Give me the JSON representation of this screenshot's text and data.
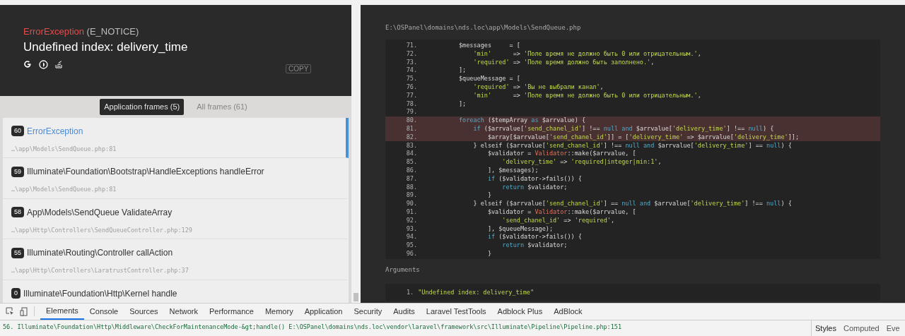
{
  "exception": {
    "class": "ErrorException",
    "type": "(E_NOTICE)",
    "message": "Undefined index: delivery_time",
    "copy_label": "COPY"
  },
  "frame_tabs": [
    {
      "label": "Application frames (5)",
      "selected": true
    },
    {
      "label": "All frames (61)",
      "selected": false
    }
  ],
  "frames": [
    {
      "number": "60",
      "name": "ErrorException",
      "file": "…\\app\\Models\\SendQueue.php:81",
      "selected": true
    },
    {
      "number": "59",
      "name": "Illuminate\\Foundation\\Bootstrap\\HandleExceptions handleError",
      "file": "…\\app\\Models\\SendQueue.php:81",
      "selected": false
    },
    {
      "number": "58",
      "name": "App\\Models\\SendQueue ValidateArray",
      "file": "…\\app\\Http\\Controllers\\SendQueueController.php:129",
      "selected": false
    },
    {
      "number": "55",
      "name": "Illuminate\\Routing\\Controller callAction",
      "file": "…\\app\\Http\\Controllers\\LaratrustController.php:37",
      "selected": false
    },
    {
      "number": "0",
      "name": "Illuminate\\Foundation\\Http\\Kernel handle",
      "selected": false
    }
  ],
  "code": {
    "path": "E:\\OSPanel\\domains\\nds.loc\\app\\Models\\SendQueue.php",
    "lines": [
      {
        "number": "71.",
        "highlighted": false,
        "tokens": [
          {
            "kind": "plain",
            "text": "        $messages     = ["
          }
        ]
      },
      {
        "number": "72.",
        "highlighted": false,
        "tokens": [
          {
            "kind": "string",
            "text": "            'min'"
          },
          {
            "kind": "plain",
            "text": "      => "
          },
          {
            "kind": "string",
            "text": "'Поле время не должно быть 0 или отрицательным.'"
          },
          {
            "kind": "plain",
            "text": ","
          }
        ]
      },
      {
        "number": "73.",
        "highlighted": false,
        "tokens": [
          {
            "kind": "string",
            "text": "            'required'"
          },
          {
            "kind": "plain",
            "text": " => "
          },
          {
            "kind": "string",
            "text": "'Поле время должно быть заполнено.'"
          },
          {
            "kind": "plain",
            "text": ","
          }
        ]
      },
      {
        "number": "74.",
        "highlighted": false,
        "tokens": [
          {
            "kind": "plain",
            "text": "        ];"
          }
        ]
      },
      {
        "number": "75.",
        "highlighted": false,
        "tokens": [
          {
            "kind": "plain",
            "text": "        $queueMessage = ["
          }
        ]
      },
      {
        "number": "76.",
        "highlighted": false,
        "tokens": [
          {
            "kind": "string",
            "text": "            'required'"
          },
          {
            "kind": "plain",
            "text": " => "
          },
          {
            "kind": "string",
            "text": "'Вы не выбрали канал'"
          },
          {
            "kind": "plain",
            "text": ","
          }
        ]
      },
      {
        "number": "77.",
        "highlighted": false,
        "tokens": [
          {
            "kind": "string",
            "text": "            'min'"
          },
          {
            "kind": "plain",
            "text": "      => "
          },
          {
            "kind": "string",
            "text": "'Поле время не должно быть 0 или отрицательным.'"
          },
          {
            "kind": "plain",
            "text": ","
          }
        ]
      },
      {
        "number": "78.",
        "highlighted": false,
        "tokens": [
          {
            "kind": "plain",
            "text": "        ];"
          }
        ]
      },
      {
        "number": "79.",
        "highlighted": false
      },
      {
        "number": "80.",
        "highlighted": true,
        "tokens": [
          {
            "kind": "keyword",
            "text": "        foreach"
          },
          {
            "kind": "plain",
            "text": " ($tempArray "
          },
          {
            "kind": "keyword",
            "text": "as"
          },
          {
            "kind": "plain",
            "text": " $arrvalue) {"
          }
        ]
      },
      {
        "number": "81.",
        "highlighted": true,
        "tokens": [
          {
            "kind": "keyword",
            "text": "            if"
          },
          {
            "kind": "plain",
            "text": " ($arrvalue["
          },
          {
            "kind": "string",
            "text": "'send_chanel_id'"
          },
          {
            "kind": "plain",
            "text": "] !== "
          },
          {
            "kind": "keyword",
            "text": "null and"
          },
          {
            "kind": "plain",
            "text": " $arrvalue["
          },
          {
            "kind": "string",
            "text": "'delivery_time'"
          },
          {
            "kind": "plain",
            "text": "] !== "
          },
          {
            "kind": "keyword",
            "text": "null"
          },
          {
            "kind": "plain",
            "text": ") {"
          }
        ]
      },
      {
        "number": "82.",
        "highlighted": true,
        "tokens": [
          {
            "kind": "plain",
            "text": "                $array[$arrvalue["
          },
          {
            "kind": "string",
            "text": "'send_chanel_id'"
          },
          {
            "kind": "plain",
            "text": "]] = ["
          },
          {
            "kind": "string",
            "text": "'delivery_time'"
          },
          {
            "kind": "plain",
            "text": " => $arrvalue["
          },
          {
            "kind": "string",
            "text": "'delivery_time'"
          },
          {
            "kind": "plain",
            "text": "]];"
          }
        ]
      },
      {
        "number": "83.",
        "highlighted": false,
        "tokens": [
          {
            "kind": "plain",
            "text": "            } "
          },
          {
            "kind": "plain",
            "text": "elseif"
          },
          {
            "kind": "plain",
            "text": " ($arrvalue["
          },
          {
            "kind": "string",
            "text": "'send_chanel_id'"
          },
          {
            "kind": "plain",
            "text": "] !== "
          },
          {
            "kind": "keyword",
            "text": "null and"
          },
          {
            "kind": "plain",
            "text": " $arrvalue["
          },
          {
            "kind": "string",
            "text": "'delivery_time'"
          },
          {
            "kind": "plain",
            "text": "] == "
          },
          {
            "kind": "keyword",
            "text": "null"
          },
          {
            "kind": "plain",
            "text": ") {"
          }
        ]
      },
      {
        "number": "84.",
        "highlighted": false,
        "tokens": [
          {
            "kind": "plain",
            "text": "                $validator = "
          },
          {
            "kind": "class",
            "text": "Validator"
          },
          {
            "kind": "plain",
            "text": "::make($arrvalue, ["
          }
        ]
      },
      {
        "number": "85.",
        "highlighted": false,
        "tokens": [
          {
            "kind": "string",
            "text": "                    'delivery_time'"
          },
          {
            "kind": "plain",
            "text": " => "
          },
          {
            "kind": "string",
            "text": "'required|integer|min:1'"
          },
          {
            "kind": "plain",
            "text": ","
          }
        ]
      },
      {
        "number": "86.",
        "highlighted": false,
        "tokens": [
          {
            "kind": "plain",
            "text": "                ], $messages);"
          }
        ]
      },
      {
        "number": "87.",
        "highlighted": false,
        "tokens": [
          {
            "kind": "keyword",
            "text": "                if"
          },
          {
            "kind": "plain",
            "text": " ($validator->fails()) {"
          }
        ]
      },
      {
        "number": "88.",
        "highlighted": false,
        "tokens": [
          {
            "kind": "keyword",
            "text": "                    return"
          },
          {
            "kind": "plain",
            "text": " $validator;"
          }
        ]
      },
      {
        "number": "89.",
        "highlighted": false,
        "tokens": [
          {
            "kind": "plain",
            "text": "                }"
          }
        ]
      },
      {
        "number": "90.",
        "highlighted": false,
        "tokens": [
          {
            "kind": "plain",
            "text": "            } elseif ($arrvalue["
          },
          {
            "kind": "string",
            "text": "'send_chanel_id'"
          },
          {
            "kind": "plain",
            "text": "] == "
          },
          {
            "kind": "keyword",
            "text": "null and"
          },
          {
            "kind": "plain",
            "text": " $arrvalue["
          },
          {
            "kind": "string",
            "text": "'delivery_time'"
          },
          {
            "kind": "plain",
            "text": "] !== "
          },
          {
            "kind": "keyword",
            "text": "null"
          },
          {
            "kind": "plain",
            "text": ") {"
          }
        ]
      },
      {
        "number": "91.",
        "highlighted": false,
        "tokens": [
          {
            "kind": "plain",
            "text": "                $validator = "
          },
          {
            "kind": "class",
            "text": "Validator"
          },
          {
            "kind": "plain",
            "text": "::make($arrvalue, ["
          }
        ]
      },
      {
        "number": "92.",
        "highlighted": false,
        "tokens": [
          {
            "kind": "string",
            "text": "                    'send_chanel_id'"
          },
          {
            "kind": "plain",
            "text": " => "
          },
          {
            "kind": "string",
            "text": "'required'"
          },
          {
            "kind": "plain",
            "text": ","
          }
        ]
      },
      {
        "number": "93.",
        "highlighted": false,
        "tokens": [
          {
            "kind": "plain",
            "text": "                ], $queueMessage);"
          }
        ]
      },
      {
        "number": "94.",
        "highlighted": false,
        "tokens": [
          {
            "kind": "keyword",
            "text": "                if"
          },
          {
            "kind": "plain",
            "text": " ($validator->fails()) {"
          }
        ]
      },
      {
        "number": "95.",
        "highlighted": false,
        "tokens": [
          {
            "kind": "keyword",
            "text": "                    return"
          },
          {
            "kind": "plain",
            "text": " $validator;"
          }
        ]
      },
      {
        "number": "96.",
        "highlighted": false,
        "tokens": [
          {
            "kind": "plain",
            "text": "                }"
          }
        ]
      }
    ]
  },
  "arguments": {
    "title": "Arguments",
    "items": [
      {
        "number": "1.",
        "value": "\"Undefined index: delivery_time\""
      }
    ]
  },
  "devtools": {
    "tabs": [
      {
        "label": "Elements",
        "selected": true
      },
      {
        "label": "Console",
        "selected": false
      },
      {
        "label": "Sources",
        "selected": false
      },
      {
        "label": "Network",
        "selected": false
      },
      {
        "label": "Performance",
        "selected": false
      },
      {
        "label": "Memory",
        "selected": false
      },
      {
        "label": "Application",
        "selected": false
      },
      {
        "label": "Security",
        "selected": false
      },
      {
        "label": "Audits",
        "selected": false
      },
      {
        "label": "Laravel TestTools",
        "selected": false
      },
      {
        "label": "Adblock Plus",
        "selected": false
      },
      {
        "label": "AdBlock",
        "selected": false
      }
    ],
    "trace_line": "56. Illuminate\\Foundation\\Http\\Middleware\\CheckForMaintenanceMode-&gt;handle() E:\\OSPanel\\domains\\nds.loc\\vendor\\laravel\\framework\\src\\Illuminate\\Pipeline\\Pipeline.php:151",
    "side_tabs": [
      {
        "label": "Styles",
        "selected": true
      },
      {
        "label": "Computed",
        "selected": false
      },
      {
        "label": "Eve",
        "selected": false
      }
    ]
  }
}
